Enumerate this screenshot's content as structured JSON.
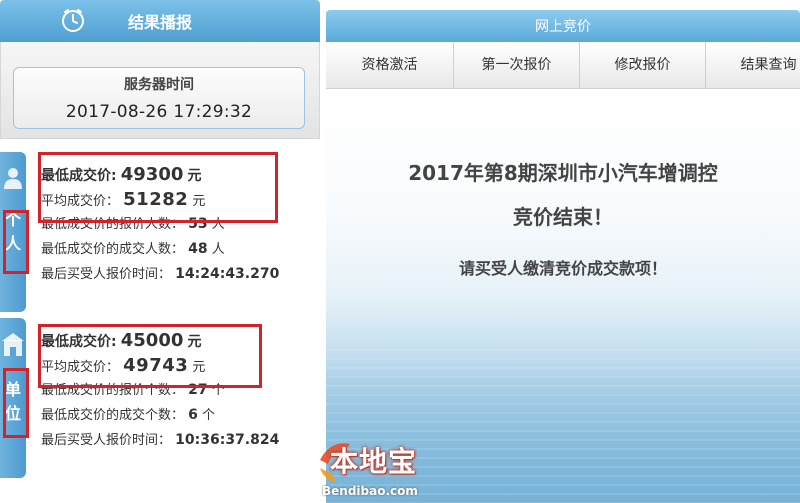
{
  "left_panel": {
    "header_title": "结果播报",
    "server_time_label": "服务器时间",
    "server_time_value": "2017-08-26 17:29:32"
  },
  "individual": {
    "tab_chars": [
      "个",
      "人"
    ],
    "min_price_label": "最低成交价:",
    "min_price_value": "49300",
    "avg_price_label": "平均成交价：",
    "avg_price_value": "51282",
    "unit_yuan": "元",
    "bidders_label": "最低成交价的报价人数：",
    "bidders_value": "53",
    "bidders_unit": "人",
    "winners_label": "最低成交价的成交人数：",
    "winners_value": "48",
    "winners_unit": "人",
    "last_time_label": "最后买受人报价时间：",
    "last_time_value": "14:24:43.270"
  },
  "organization": {
    "tab_chars": [
      "单",
      "位"
    ],
    "min_price_label": "最低成交价:",
    "min_price_value": "45000",
    "avg_price_label": "平均成交价：",
    "avg_price_value": "49743",
    "unit_yuan": "元",
    "bidders_label": "最低成交价的报价个数：",
    "bidders_value": "27",
    "bidders_unit": "个",
    "winners_label": "最低成交价的成交个数：",
    "winners_value": "6",
    "winners_unit": "个",
    "last_time_label": "最后买受人报价时间：",
    "last_time_value": "10:36:37.824"
  },
  "right_panel": {
    "header_title": "网上竞价",
    "tabs": [
      "资格激活",
      "第一次报价",
      "修改报价",
      "结果查询"
    ],
    "message_line1": "2017年第8期深圳市小汽车增调控",
    "message_line2": "竞价结束！",
    "message_line3": "请买受人缴清竞价成交款项！"
  },
  "watermark": {
    "name_cn": "本地宝",
    "site": "Bendibao.com"
  },
  "colors": {
    "header_blue": "#5aa9d9",
    "highlight_red": "#d2232a"
  }
}
